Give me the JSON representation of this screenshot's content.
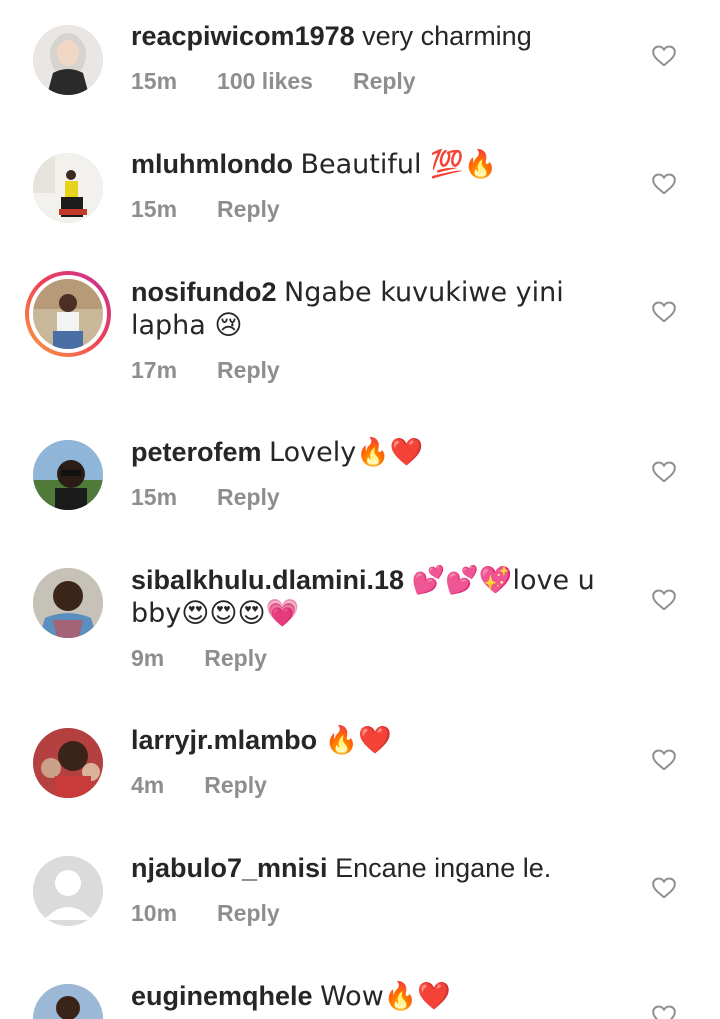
{
  "comments": [
    {
      "username": "reacpiwicom1978",
      "text": "very charming",
      "time": "15m",
      "likes": "100 likes",
      "reply": "Reply"
    },
    {
      "username": "mluhmlondo",
      "text": "Beautiful 💯🔥",
      "time": "15m",
      "likes": "",
      "reply": "Reply"
    },
    {
      "username": "nosifundo2",
      "text": "Ngabe kuvukiwe yini lapha 😢",
      "time": "17m",
      "likes": "",
      "reply": "Reply"
    },
    {
      "username": "peterofem",
      "text": "Lovely🔥❤️",
      "time": "15m",
      "likes": "",
      "reply": "Reply"
    },
    {
      "username": "sibalkhulu.dlamini.18",
      "text": "💕💕💖love u bby😍😍😍💗",
      "time": "9m",
      "likes": "",
      "reply": "Reply"
    },
    {
      "username": "larryjr.mlambo",
      "text": "🔥❤️",
      "time": "4m",
      "likes": "",
      "reply": "Reply"
    },
    {
      "username": "njabulo7_mnisi",
      "text": "Encane ingane le.",
      "time": "10m",
      "likes": "",
      "reply": "Reply"
    },
    {
      "username": "euginemqhele",
      "text": "Wow🔥❤️",
      "time": "",
      "likes": "",
      "reply": ""
    }
  ],
  "colors": {
    "text": "#262626",
    "meta": "#8e8e8e",
    "story_ring_start": "#f9a13a",
    "story_ring_end": "#c1309a"
  },
  "icons": {
    "like": "heart-outline-icon",
    "default_avatar": "default-avatar-icon"
  }
}
